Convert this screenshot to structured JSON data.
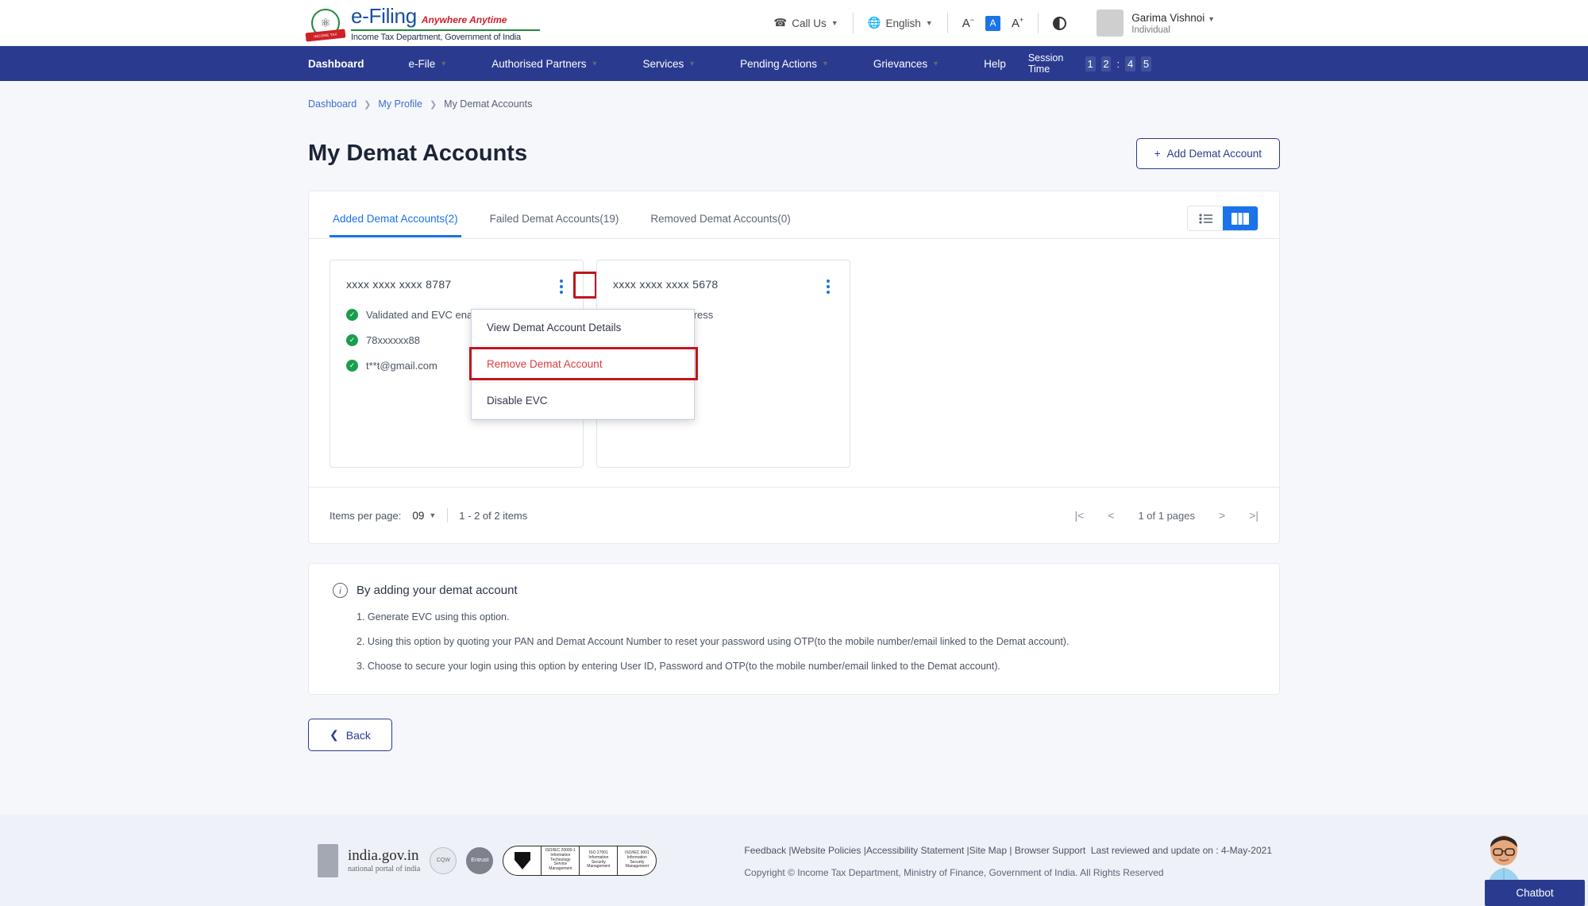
{
  "header": {
    "logo": {
      "brand": "e-Filing",
      "tagline": "Anywhere Anytime",
      "subtitle": "Income Tax Department, Government of India",
      "ribbon": "INCOME TAX DEPARTMENT"
    },
    "call_us": "Call Us",
    "language": "English",
    "font_decrease": "A",
    "font_normal": "A",
    "font_increase": "A",
    "user_name": "Garima Vishnoi",
    "user_role": "Individual"
  },
  "nav": {
    "items": [
      {
        "label": "Dashboard",
        "has_caret": false
      },
      {
        "label": "e-File",
        "has_caret": true
      },
      {
        "label": "Authorised Partners",
        "has_caret": true
      },
      {
        "label": "Services",
        "has_caret": true
      },
      {
        "label": "Pending Actions",
        "has_caret": true
      },
      {
        "label": "Grievances",
        "has_caret": true
      },
      {
        "label": "Help",
        "has_caret": false
      }
    ],
    "session_label": "Session Time",
    "session_digits": [
      "1",
      "2",
      "4",
      "5"
    ]
  },
  "breadcrumb": {
    "items": [
      "Dashboard",
      "My Profile"
    ],
    "current": "My Demat Accounts"
  },
  "page": {
    "title": "My Demat Accounts",
    "add_button": "Add Demat Account",
    "add_icon": "plus-icon"
  },
  "tabs": [
    {
      "label": "Added Demat Accounts(2)",
      "active": true
    },
    {
      "label": "Failed Demat Accounts(19)",
      "active": false
    },
    {
      "label": "Removed Demat Accounts(0)",
      "active": false
    }
  ],
  "view_toggle": {
    "list_icon": "list-view-icon",
    "grid_icon": "grid-view-icon",
    "active": "grid"
  },
  "cards": [
    {
      "account_number": "xxxx xxxx xxxx 8787",
      "statuses": [
        "Validated and EVC enabled",
        "78xxxxxx88",
        "t**t@gmail.com"
      ]
    },
    {
      "account_number": "xxxx xxxx xxxx 5678",
      "statuses": [
        "Validation In Progress"
      ]
    }
  ],
  "dropdown": {
    "items": [
      {
        "label": "View Demat Account Details",
        "danger": false
      },
      {
        "label": "Remove Demat Account",
        "danger": true
      },
      {
        "label": "Disable EVC",
        "danger": false
      }
    ],
    "highlight_color": "#c0161c",
    "danger_color": "#e03b3b"
  },
  "pagination": {
    "items_per_page_label": "Items per page:",
    "items_per_page_value": "09",
    "range_text": "1 - 2 of 2 items",
    "first": "|<",
    "prev": "<",
    "pages_text": "1 of 1 pages",
    "next": ">",
    "last": ">|"
  },
  "info": {
    "title": "By adding your demat account",
    "items": [
      "1. Generate EVC using this option.",
      "2. Using this option by quoting your PAN and Demat Account Number to reset your password using OTP(to the mobile number/email linked to the Demat account).",
      "3. Choose to secure your login using this option by entering User ID, Password and OTP(to the mobile number/email linked to the Demat account)."
    ]
  },
  "back_button": {
    "label": "Back",
    "icon": "chevron-left-icon"
  },
  "footer": {
    "india_portal_title": "india.gov.in",
    "india_portal_sub": "national portal of india",
    "badges": [
      "CQW",
      "Entrust"
    ],
    "iso_segments": [
      "bsi",
      "ISO/IEC 20000-1 Information Technology Service Management",
      "ISO 27001 Information Security Management",
      "ISO/IEC 9001 Information Security Management"
    ],
    "links": [
      "Feedback",
      "Website Policies",
      "Accessibility Statement",
      "Site Map",
      "Browser Support"
    ],
    "last_reviewed": "Last reviewed and update on : 4-May-2021",
    "copyright": "Copyright © Income Tax Department, Ministry of Finance, Government of India. All Rights Reserved"
  },
  "chatbot": {
    "label": "Chatbot"
  },
  "colors": {
    "nav_blue": "#2a3b8f",
    "accent_blue": "#1a73e8",
    "danger_red": "#e03b3b",
    "annotation_red": "#c0161c",
    "success_green": "#1a9e4b"
  }
}
